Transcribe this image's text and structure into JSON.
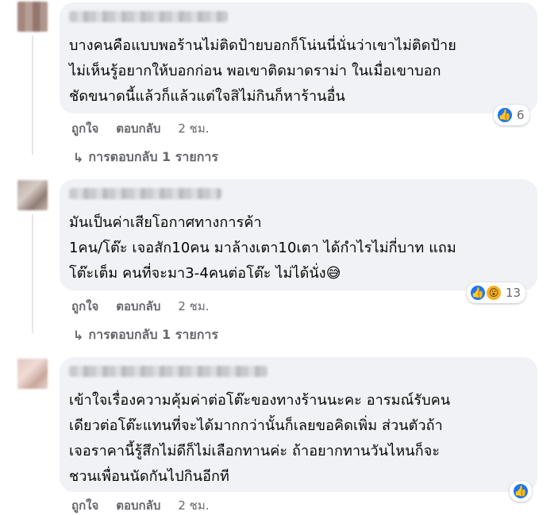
{
  "comments": [
    {
      "text": "บางคนคือแบบพอร้านไม่ติดป้ายบอกก็โน่นนี่นั่นว่าเขาไม่ติดป้าย\nไม่เห็นรู้อยากให้บอกก่อน พอเขาติดมาดราม่า ในเมื่อเขาบอก\nชัดขนาดนี้แล้วก็แล้วแต่ใจสิไม่กินก็หาร้านอื่น",
      "reaction_count": "6",
      "like_label": "ถูกใจ",
      "reply_label": "ตอบกลับ",
      "time": "2 ชม.",
      "replies_link": "การตอบกลับ 1 รายการ"
    },
    {
      "text": "มันเป็นค่าเสียโอกาศทางการค้า\n1คน/โต๊ะ เจอสัก10คน มาล้างเตา10เตา ได้กำไรไม่กี่บาท แถม\nโต๊ะเต็ม คนที่จะมา3-4คนต่อโต๊ะ ไม่ได้นั่ง😅",
      "reaction_count": "13",
      "like_label": "ถูกใจ",
      "reply_label": "ตอบกลับ",
      "time": "2 ชม.",
      "replies_link": "การตอบกลับ 1 รายการ"
    },
    {
      "text": "เข้าใจเรื่องความคุ้มค่าต่อโต๊ะของทางร้านนะคะ อารมณ์รับคน\nเดียวต่อโต๊ะแทนที่จะได้มากกว่านั้นก็เลยขอคิดเพิ่ม ส่วนตัวถ้า\nเจอราคานี้รู้สึกไม่ดีก็ไม่เลือกทานค่ะ ถ้าอยากทานวันไหนก็จะ\nชวนเพื่อนนัดกันไปกินอีกที",
      "like_label": "ถูกใจ",
      "reply_label": "ตอบกลับ",
      "time": "2 ชม."
    }
  ],
  "icons": {
    "like": "thumbs-up-icon",
    "wow": "wow-face-icon",
    "reply_arrow": "reply-arrow-icon"
  },
  "colors": {
    "bubble": "#f0f2f5",
    "like": "#1877f2",
    "meta": "#65676b"
  }
}
